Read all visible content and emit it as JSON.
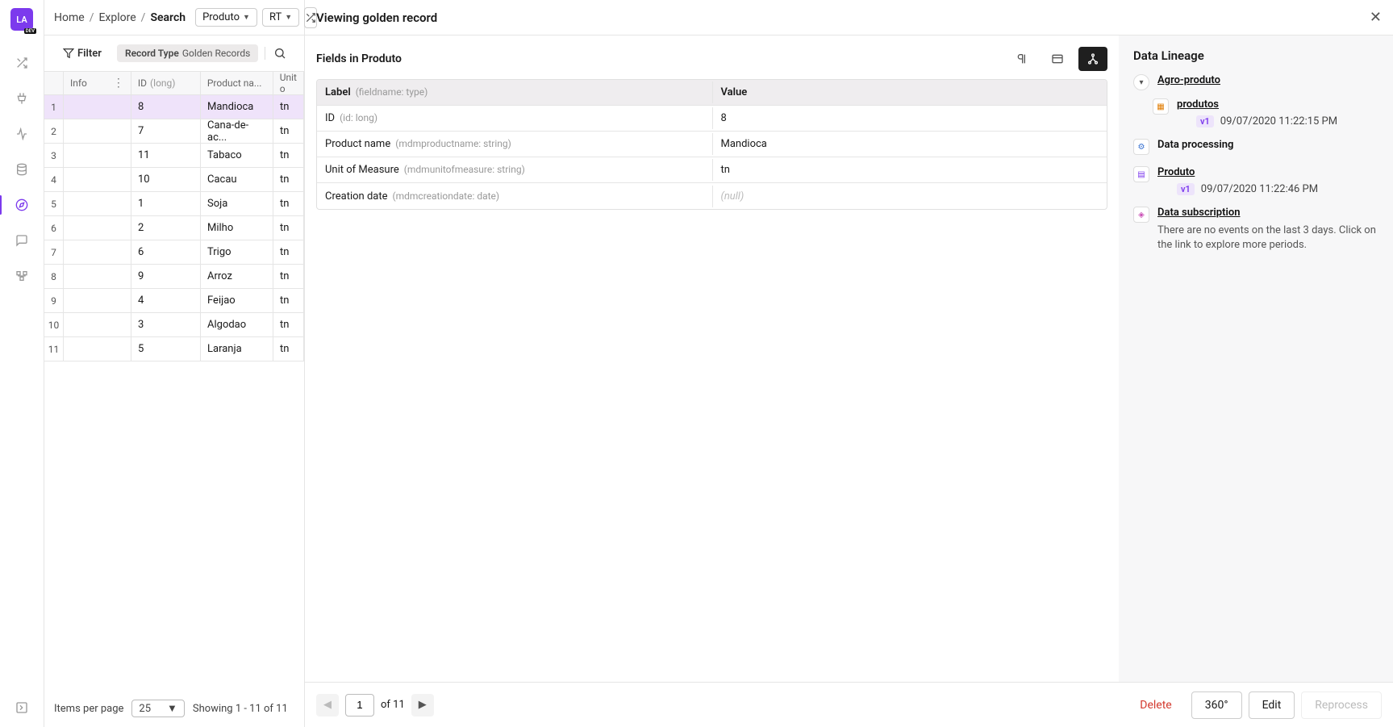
{
  "logo": "LA",
  "logo_tag": "DEV",
  "breadcrumb": {
    "home": "Home",
    "explore": "Explore",
    "current": "Search"
  },
  "pills": {
    "product": "Produto",
    "rt": "RT"
  },
  "filter": {
    "label": "Filter",
    "chip_key": "Record Type",
    "chip_val": "Golden Records"
  },
  "grid": {
    "headers": {
      "info": "Info",
      "id": "ID",
      "id_type": "(long)",
      "name": "Product na...",
      "unit": "Unit o"
    },
    "rows": [
      {
        "n": "1",
        "id": "8",
        "name": "Mandioca",
        "unit": "tn",
        "selected": true
      },
      {
        "n": "2",
        "id": "7",
        "name": "Cana-de-ac...",
        "unit": "tn"
      },
      {
        "n": "3",
        "id": "11",
        "name": "Tabaco",
        "unit": "tn"
      },
      {
        "n": "4",
        "id": "10",
        "name": "Cacau",
        "unit": "tn"
      },
      {
        "n": "5",
        "id": "1",
        "name": "Soja",
        "unit": "tn"
      },
      {
        "n": "6",
        "id": "2",
        "name": "Milho",
        "unit": "tn"
      },
      {
        "n": "7",
        "id": "6",
        "name": "Trigo",
        "unit": "tn"
      },
      {
        "n": "8",
        "id": "9",
        "name": "Arroz",
        "unit": "tn"
      },
      {
        "n": "9",
        "id": "4",
        "name": "Feijao",
        "unit": "tn"
      },
      {
        "n": "10",
        "id": "3",
        "name": "Algodao",
        "unit": "tn"
      },
      {
        "n": "11",
        "id": "5",
        "name": "Laranja",
        "unit": "tn"
      }
    ],
    "pager": {
      "ipp_label": "Items per page",
      "ipp_value": "25",
      "showing": "Showing 1 - 11 of 11"
    }
  },
  "detail": {
    "title": "Viewing golden record",
    "section": "Fields in Produto",
    "header_label": "Label",
    "header_meta": "(fieldname: type)",
    "header_value": "Value",
    "fields": [
      {
        "label": "ID",
        "meta": "(id: long)",
        "value": "8"
      },
      {
        "label": "Product name",
        "meta": "(mdmproductname: string)",
        "value": "Mandioca"
      },
      {
        "label": "Unit of Measure",
        "meta": "(mdmunitofmeasure: string)",
        "value": "tn"
      },
      {
        "label": "Creation date",
        "meta": "(mdmcreationdate: date)",
        "value": "(null)",
        "null": true
      }
    ]
  },
  "lineage": {
    "title": "Data Lineage",
    "agro": "Agro-produto",
    "produtos": "produtos",
    "produtos_ver": "v1",
    "produtos_time": "09/07/2020 11:22:15 PM",
    "processing": "Data processing",
    "produto": "Produto",
    "produto_ver": "v1",
    "produto_time": "09/07/2020 11:22:46 PM",
    "sub": "Data subscription",
    "sub_msg": "There are no events on the last 3 days. Click on the link to explore more periods."
  },
  "footer": {
    "page": "1",
    "of": "of 11",
    "delete": "Delete",
    "deg": "360°",
    "edit": "Edit",
    "reprocess": "Reprocess"
  }
}
